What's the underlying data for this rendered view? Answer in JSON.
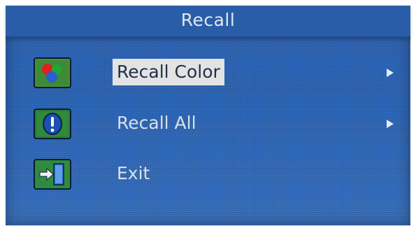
{
  "menu": {
    "title": "Recall",
    "items": [
      {
        "label": "Recall Color",
        "icon": "rgb-color-icon",
        "selected": true,
        "has_submenu": true
      },
      {
        "label": "Recall All",
        "icon": "exclamation-icon",
        "selected": false,
        "has_submenu": true
      },
      {
        "label": "Exit",
        "icon": "exit-door-icon",
        "selected": false,
        "has_submenu": false
      }
    ]
  },
  "colors": {
    "background": "#2f67b9",
    "selection_highlight": "#e3e3e3",
    "text": "#d8e0ea"
  }
}
